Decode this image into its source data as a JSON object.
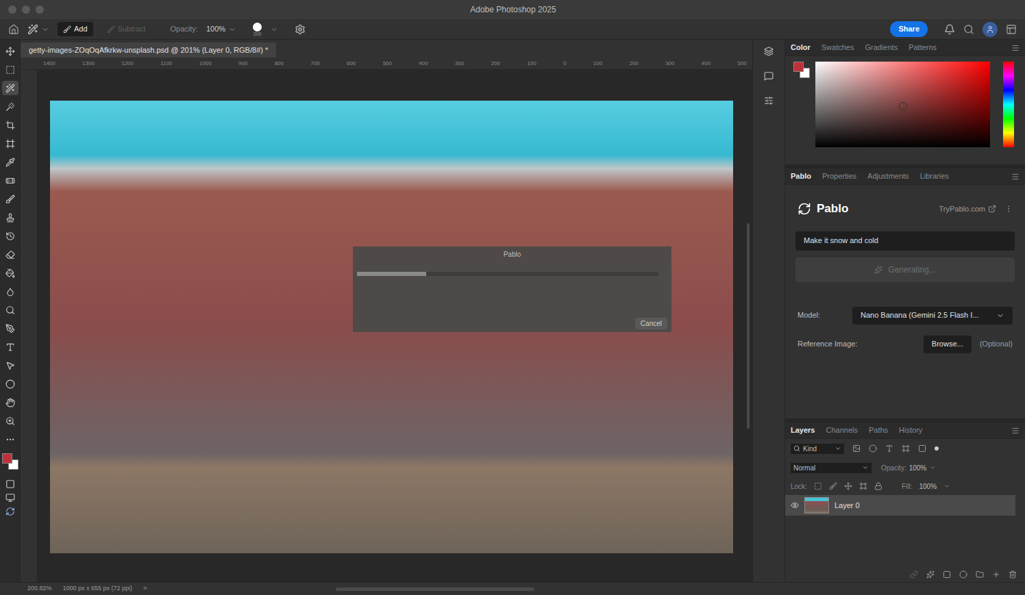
{
  "window": {
    "title": "Adobe Photoshop 2025"
  },
  "options_bar": {
    "modes": [
      {
        "label": "Add",
        "selected": true
      },
      {
        "label": "Subtract",
        "selected": false
      }
    ],
    "opacity_label": "Opacity:",
    "opacity": "100%",
    "brush_size": "200",
    "share": "Share"
  },
  "document": {
    "tab": "getty-images-ZOqOqAfkrkw-unsplash.psd @ 201% (Layer 0, RGB/8#) *"
  },
  "ruler": {
    "ticks": [
      "1400",
      "1300",
      "1200",
      "1100",
      "1000",
      "900",
      "800",
      "700",
      "600",
      "500",
      "400",
      "300",
      "200",
      "100",
      "0",
      "100",
      "200",
      "300",
      "400",
      "500"
    ]
  },
  "tools": [
    {
      "kind": "move",
      "selected": false
    },
    {
      "kind": "marquee",
      "selected": false
    },
    {
      "kind": "quick-select",
      "selected": true
    },
    {
      "kind": "magic-wand",
      "selected": false
    },
    {
      "kind": "crop",
      "selected": false
    },
    {
      "kind": "frame",
      "selected": false
    },
    {
      "kind": "eyedropper",
      "selected": false
    },
    {
      "kind": "healing",
      "selected": false
    },
    {
      "kind": "brush",
      "selected": false
    },
    {
      "kind": "stamp",
      "selected": false
    },
    {
      "kind": "history",
      "selected": false
    },
    {
      "kind": "eraser",
      "selected": false
    },
    {
      "kind": "bucket",
      "selected": false
    },
    {
      "kind": "blur",
      "selected": false
    },
    {
      "kind": "dodge",
      "selected": false
    },
    {
      "kind": "pen",
      "selected": false
    },
    {
      "kind": "type",
      "selected": false
    },
    {
      "kind": "path-select",
      "selected": false
    },
    {
      "kind": "shape",
      "selected": false
    },
    {
      "kind": "hand",
      "selected": false
    },
    {
      "kind": "zoom",
      "selected": false
    },
    {
      "kind": "more",
      "selected": false
    }
  ],
  "progress_dialog": {
    "title": "Pablo",
    "level": 0.23,
    "button": "Cancel"
  },
  "color_panel": {
    "tabs": [
      {
        "label": "Color",
        "selected": true
      },
      {
        "label": "Swatches",
        "selected": false
      },
      {
        "label": "Gradients",
        "selected": false
      },
      {
        "label": "Patterns",
        "selected": false
      }
    ],
    "foreground": "#c0303a",
    "background": "#ffffff"
  },
  "plugin_panel": {
    "tabs": [
      {
        "label": "Pablo",
        "selected": true
      },
      {
        "label": "Properties",
        "selected": false
      },
      {
        "label": "Adjustments",
        "selected": false
      },
      {
        "label": "Libraries",
        "selected": false
      }
    ],
    "name": "Pablo",
    "link": "TryPablo.com",
    "prompt": "Make it snow and cold",
    "generate_button": {
      "label": "Generating...",
      "disabled": true
    },
    "model_label": "Model:",
    "model": "Nano Banana (Gemini 2.5 Flash I...",
    "reference_label": "Reference Image:",
    "browse": "Browse...",
    "optional": "(Optional)"
  },
  "layers_panel": {
    "tabs": [
      {
        "label": "Layers",
        "selected": true
      },
      {
        "label": "Channels",
        "selected": false
      },
      {
        "label": "Paths",
        "selected": false
      },
      {
        "label": "History",
        "selected": false
      }
    ],
    "filter": "Kind",
    "blend_mode": "Normal",
    "opacity_label": "Opacity:",
    "opacity": "100%",
    "lock_label": "Lock:",
    "fill_label": "Fill:",
    "fill": "100%",
    "layers": [
      {
        "name": "Layer 0",
        "visible": true,
        "selected": true
      }
    ]
  },
  "status_bar": {
    "zoom": "200.82%",
    "size": "1000 px x 655 px (72 ppi)",
    "arrow": ">"
  }
}
